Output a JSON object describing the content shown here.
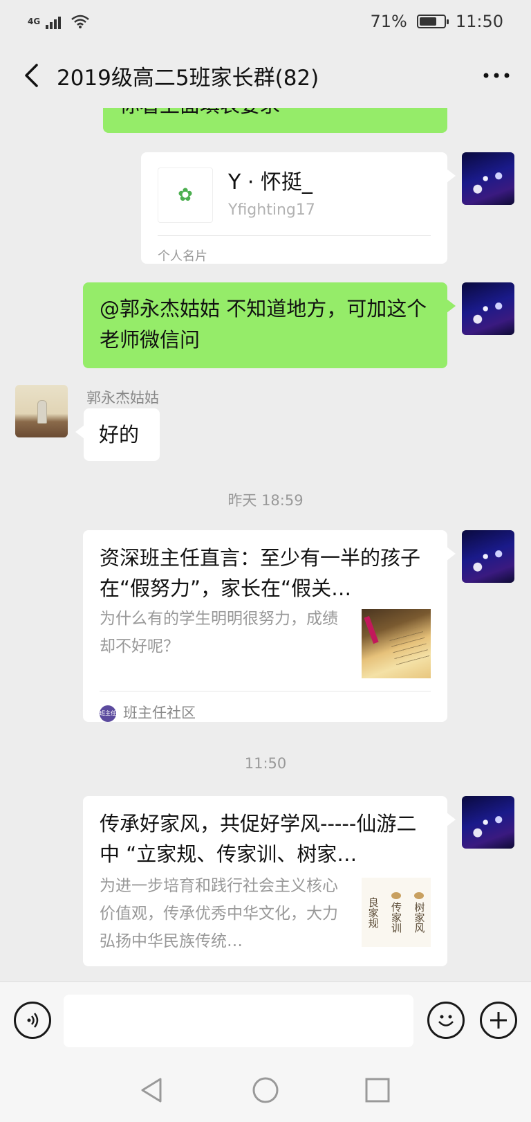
{
  "status_bar": {
    "network": "4G",
    "battery_percent": "71%",
    "battery_level": 0.71,
    "time": "11:50"
  },
  "nav": {
    "title": "2019级高二5班家长群(82)"
  },
  "messages": {
    "partial_top": "你看上面填表要求",
    "contact_card": {
      "name": "Y · 怀挺_",
      "id": "Yfighting17",
      "footer": "个人名片",
      "icon_glyph": "✿"
    },
    "self_text": "@郭永杰姑姑  不知道地方，可加这个老师微信问",
    "other_sender": "郭永杰姑姑",
    "other_text": "好的",
    "timestamp_1": "昨天 18:59",
    "article_1": {
      "title": "资深班主任直言：至少有一半的孩子在“假努力”，家长在“假关…",
      "desc": "为什么有的学生明明很努力，成绩却不好呢？",
      "source": "班主任社区",
      "source_logo": "班主任"
    },
    "timestamp_2": "11:50",
    "article_2": {
      "title": "传承好家风，共促好学风-----仙游二中 “立家规、传家训、树家…",
      "desc": "为进一步培育和践行社会主义核心价值观，传承优秀中华文化，大力弘扬中华民族传统…",
      "thumb_text": [
        "良家规",
        "传家训",
        "树家风"
      ]
    }
  },
  "input_bar": {
    "placeholder": ""
  }
}
